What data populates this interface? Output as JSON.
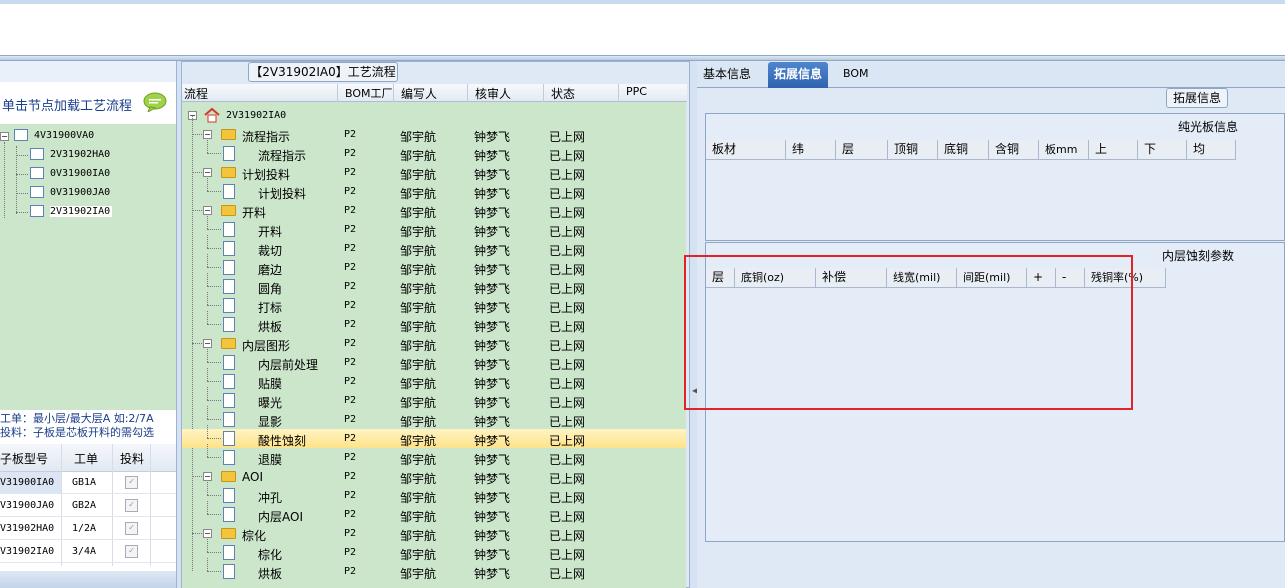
{
  "left_panel": {
    "header": "单击节点加载工艺流程",
    "tree": [
      "4V31900VA0",
      "2V31902HA0",
      "0V31900IA0",
      "0V31900JA0",
      "2V31902IA0"
    ],
    "note_line1": "工单：最小层/最大层A 如:2/7A",
    "note_line2": "投料：子板是芯板开料的需勾选",
    "table_headers": [
      "子板型号",
      "工单",
      "投料"
    ],
    "table_rows": [
      {
        "model": "V31900IA0",
        "order": "GB1A"
      },
      {
        "model": "V31900JA0",
        "order": "GB2A"
      },
      {
        "model": "V31902HA0",
        "order": "1/2A"
      },
      {
        "model": "V31902IA0",
        "order": "3/4A"
      }
    ]
  },
  "middle_panel": {
    "title": "【2V31902IA0】工艺流程",
    "headers": [
      "流程",
      "BOM工厂",
      "编写人",
      "核审人",
      "状态",
      "PPC"
    ],
    "root": "2V31902IA0",
    "rows": [
      {
        "name": "流程指示",
        "level": 1,
        "bom": "P2",
        "writer": "邹宇航",
        "reviewer": "钟梦飞",
        "status": "已上网"
      },
      {
        "name": "流程指示",
        "level": 2,
        "bom": "P2",
        "writer": "邹宇航",
        "reviewer": "钟梦飞",
        "status": "已上网"
      },
      {
        "name": "计划投料",
        "level": 1,
        "bom": "P2",
        "writer": "邹宇航",
        "reviewer": "钟梦飞",
        "status": "已上网"
      },
      {
        "name": "计划投料",
        "level": 2,
        "bom": "P2",
        "writer": "邹宇航",
        "reviewer": "钟梦飞",
        "status": "已上网"
      },
      {
        "name": "开料",
        "level": 1,
        "bom": "P2",
        "writer": "邹宇航",
        "reviewer": "钟梦飞",
        "status": "已上网"
      },
      {
        "name": "开料",
        "level": 2,
        "bom": "P2",
        "writer": "邹宇航",
        "reviewer": "钟梦飞",
        "status": "已上网"
      },
      {
        "name": "裁切",
        "level": 2,
        "bom": "P2",
        "writer": "邹宇航",
        "reviewer": "钟梦飞",
        "status": "已上网"
      },
      {
        "name": "磨边",
        "level": 2,
        "bom": "P2",
        "writer": "邹宇航",
        "reviewer": "钟梦飞",
        "status": "已上网"
      },
      {
        "name": "圆角",
        "level": 2,
        "bom": "P2",
        "writer": "邹宇航",
        "reviewer": "钟梦飞",
        "status": "已上网"
      },
      {
        "name": "打标",
        "level": 2,
        "bom": "P2",
        "writer": "邹宇航",
        "reviewer": "钟梦飞",
        "status": "已上网"
      },
      {
        "name": "烘板",
        "level": 2,
        "bom": "P2",
        "writer": "邹宇航",
        "reviewer": "钟梦飞",
        "status": "已上网"
      },
      {
        "name": "内层图形",
        "level": 1,
        "bom": "P2",
        "writer": "邹宇航",
        "reviewer": "钟梦飞",
        "status": "已上网"
      },
      {
        "name": "内层前处理",
        "level": 2,
        "bom": "P2",
        "writer": "邹宇航",
        "reviewer": "钟梦飞",
        "status": "已上网"
      },
      {
        "name": "贴膜",
        "level": 2,
        "bom": "P2",
        "writer": "邹宇航",
        "reviewer": "钟梦飞",
        "status": "已上网"
      },
      {
        "name": "曝光",
        "level": 2,
        "bom": "P2",
        "writer": "邹宇航",
        "reviewer": "钟梦飞",
        "status": "已上网"
      },
      {
        "name": "显影",
        "level": 2,
        "bom": "P2",
        "writer": "邹宇航",
        "reviewer": "钟梦飞",
        "status": "已上网"
      },
      {
        "name": "酸性蚀刻",
        "level": 2,
        "bom": "P2",
        "writer": "邹宇航",
        "reviewer": "钟梦飞",
        "status": "已上网",
        "selected": true
      },
      {
        "name": "退膜",
        "level": 2,
        "bom": "P2",
        "writer": "邹宇航",
        "reviewer": "钟梦飞",
        "status": "已上网"
      },
      {
        "name": "AOI",
        "level": 1,
        "bom": "P2",
        "writer": "邹宇航",
        "reviewer": "钟梦飞",
        "status": "已上网"
      },
      {
        "name": "冲孔",
        "level": 2,
        "bom": "P2",
        "writer": "邹宇航",
        "reviewer": "钟梦飞",
        "status": "已上网"
      },
      {
        "name": "内层AOI",
        "level": 2,
        "bom": "P2",
        "writer": "邹宇航",
        "reviewer": "钟梦飞",
        "status": "已上网"
      },
      {
        "name": "棕化",
        "level": 1,
        "bom": "P2",
        "writer": "邹宇航",
        "reviewer": "钟梦飞",
        "status": "已上网"
      },
      {
        "name": "棕化",
        "level": 2,
        "bom": "P2",
        "writer": "邹宇航",
        "reviewer": "钟梦飞",
        "status": "已上网"
      },
      {
        "name": "烘板",
        "level": 2,
        "bom": "P2",
        "writer": "邹宇航",
        "reviewer": "钟梦飞",
        "status": "已上网"
      }
    ]
  },
  "right_panel": {
    "tabs": [
      "基本信息",
      "拓展信息",
      "BOM"
    ],
    "active_tab": "拓展信息",
    "group_label": "拓展信息",
    "grid1_title": "纯光板信息",
    "grid1_headers": [
      "板材",
      "纬",
      "层",
      "顶铜",
      "底铜",
      "含铜",
      "板mm",
      "上",
      "下",
      "均"
    ],
    "grid2_title": "内层蚀刻参数",
    "grid2_headers": [
      "层",
      "底铜(oz)",
      "补偿",
      "线宽(mil)",
      "间距(mil)",
      "+",
      "-",
      "残铜率(%)"
    ]
  },
  "colors": {
    "tree_background": "#cce6cc",
    "selection": "#fde38a",
    "active_tab": "#2f63ad",
    "highlight_box": "#e0242a"
  }
}
